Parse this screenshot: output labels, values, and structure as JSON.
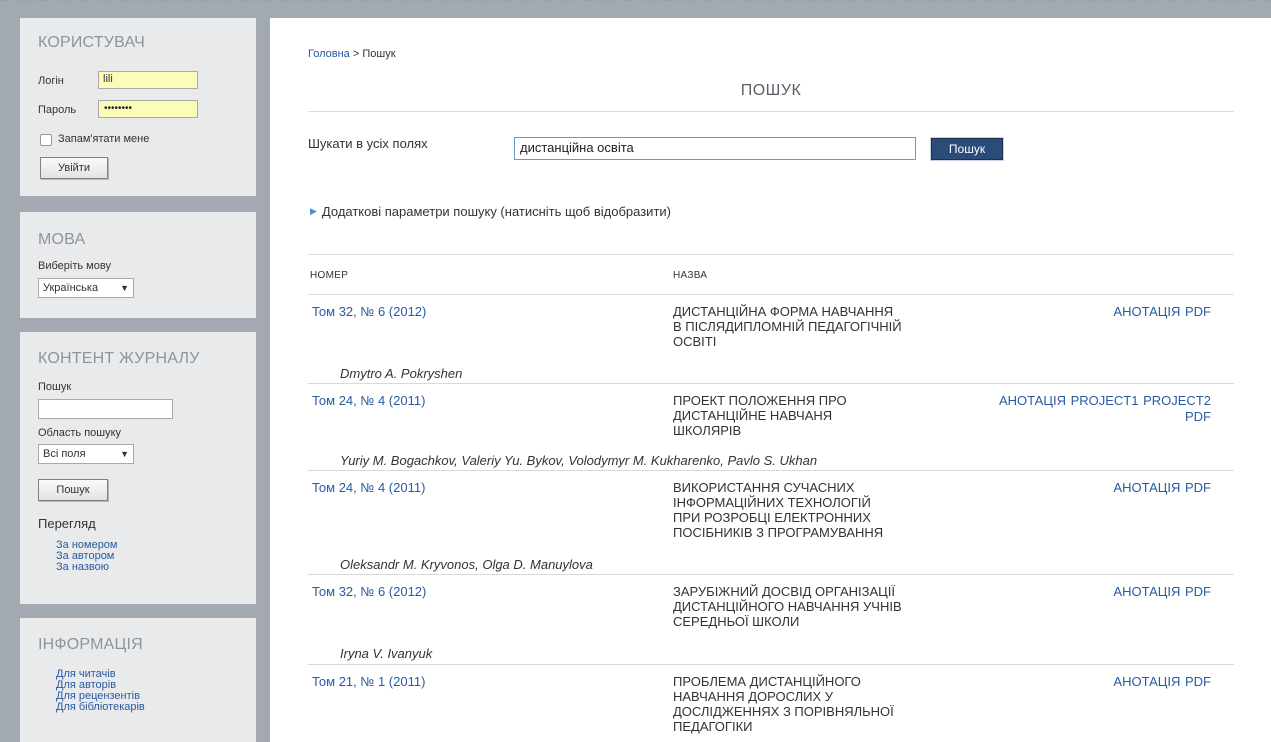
{
  "sidebar": {
    "user": {
      "title": "КОРИСТУВАЧ",
      "login_label": "Логін",
      "login_value": "lili",
      "password_label": "Пароль",
      "password_mask": "••••••••",
      "remember_label": "Запам'ятати мене",
      "login_button": "Увійти"
    },
    "language": {
      "title": "МОВА",
      "choose_label": "Виберіть мову",
      "selected": "Українська"
    },
    "content": {
      "title": "КОНТЕНТ ЖУРНАЛУ",
      "search_label": "Пошук",
      "scope_label": "Область пошуку",
      "scope_selected": "Всі поля",
      "search_button": "Пошук",
      "browse_label": "Перегляд",
      "browse_links": [
        "За номером",
        "За автором",
        "За назвою"
      ]
    },
    "info": {
      "title": "ІНФОРМАЦІЯ",
      "links": [
        "Для читачів",
        "Для авторів",
        "Для рецензентів",
        "Для бібліотекарів"
      ]
    }
  },
  "main": {
    "breadcrumb": {
      "home": "Головна",
      "separator": " > ",
      "current": "Пошук"
    },
    "title": "ПОШУК",
    "search_all_label": "Шукати в усіх полях",
    "search_value": "дистанційна освіта",
    "search_button": "Пошук",
    "advanced_toggle": "Додаткові параметри пошуку (натисніть щоб відобразити)",
    "columns": {
      "issue": "НОМЕР",
      "title": "НАЗВА"
    },
    "results": [
      {
        "issue": "Том 32, № 6 (2012)",
        "title": "ДИСТАНЦІЙНА ФОРМА НАВЧАННЯ В ПІСЛЯДИПЛОМНІЙ ПЕДАГОГІЧНІЙ ОСВІТІ",
        "title_lines": [
          "ДИСТАНЦІЙНА ФОРМА НАВЧАННЯ",
          "В ПІСЛЯДИПЛОМНІЙ ПЕДАГОГІЧНІЙ",
          "ОСВІТІ"
        ],
        "links_line1": "АНОТАЦІЯ  PDF",
        "links_line2": "",
        "authors": "Dmytro A. Pokryshen"
      },
      {
        "issue": "Том 24, № 4 (2011)",
        "title": "ПРОЕКТ ПОЛОЖЕННЯ ПРО ДИСТАНЦІЙНЕ НАВЧАНЯ ШКОЛЯРІВ",
        "title_lines": [
          "ПРОЕКТ ПОЛОЖЕННЯ ПРО",
          "ДИСТАНЦІЙНЕ НАВЧАНЯ",
          "ШКОЛЯРІВ"
        ],
        "links_line1": "АНОТАЦІЯ  PROJECT1  PROJECT2",
        "links_line2": "PDF",
        "authors": "Yuriy M. Bogachkov, Valeriy Yu. Bykov, Volodymyr M. Kukharenko, Pavlo S. Ukhan"
      },
      {
        "issue": "Том 24, № 4 (2011)",
        "title": "ВИКОРИСТАННЯ СУЧАСНИХ ІНФОРМАЦІЙНИХ ТЕХНОЛОГІЙ ПРИ РОЗРОБЦІ ЕЛЕКТРОННИХ ПОСІБНИКІВ З ПРОГРАМУВАННЯ",
        "title_lines": [
          "ВИКОРИСТАННЯ СУЧАСНИХ",
          "ІНФОРМАЦІЙНИХ ТЕХНОЛОГІЙ",
          "ПРИ РОЗРОБЦІ ЕЛЕКТРОННИХ",
          "ПОСІБНИКІВ З ПРОГРАМУВАННЯ"
        ],
        "links_line1": "АНОТАЦІЯ  PDF",
        "links_line2": "",
        "authors": "Oleksandr M. Kryvonos, Olga D. Manuylova"
      },
      {
        "issue": "Том 32, № 6 (2012)",
        "title": "ЗАРУБІЖНИЙ ДОСВІД ОРГАНІЗАЦІЇ ДИСТАНЦІЙНОГО НАВЧАННЯ УЧНІВ СЕРЕДНЬОЇ ШКОЛИ",
        "title_lines": [
          "ЗАРУБІЖНИЙ ДОСВІД ОРГАНІЗАЦІЇ",
          "ДИСТАНЦІЙНОГО НАВЧАННЯ УЧНІВ",
          "СЕРЕДНЬОЇ ШКОЛИ"
        ],
        "links_line1": "АНОТАЦІЯ  PDF",
        "links_line2": "",
        "authors": "Iryna V. Ivanyuk"
      },
      {
        "issue": "Том 21, № 1 (2011)",
        "title": "ПРОБЛЕМА ДИСТАНЦІЙНОГО НАВЧАННЯ ДОРОСЛИХ У ДОСЛІДЖЕННЯХ З ПОРІВНЯЛЬНОЇ ПЕДАГОГІКИ",
        "title_lines": [
          "ПРОБЛЕМА ДИСТАНЦІЙНОГО",
          "НАВЧАННЯ ДОРОСЛИХ У",
          "ДОСЛІДЖЕННЯХ З ПОРІВНЯЛЬНОЇ",
          "ПЕДАГОГІКИ"
        ],
        "links_line1": "АНОТАЦІЯ  PDF",
        "links_line2": "",
        "authors": ""
      }
    ]
  }
}
